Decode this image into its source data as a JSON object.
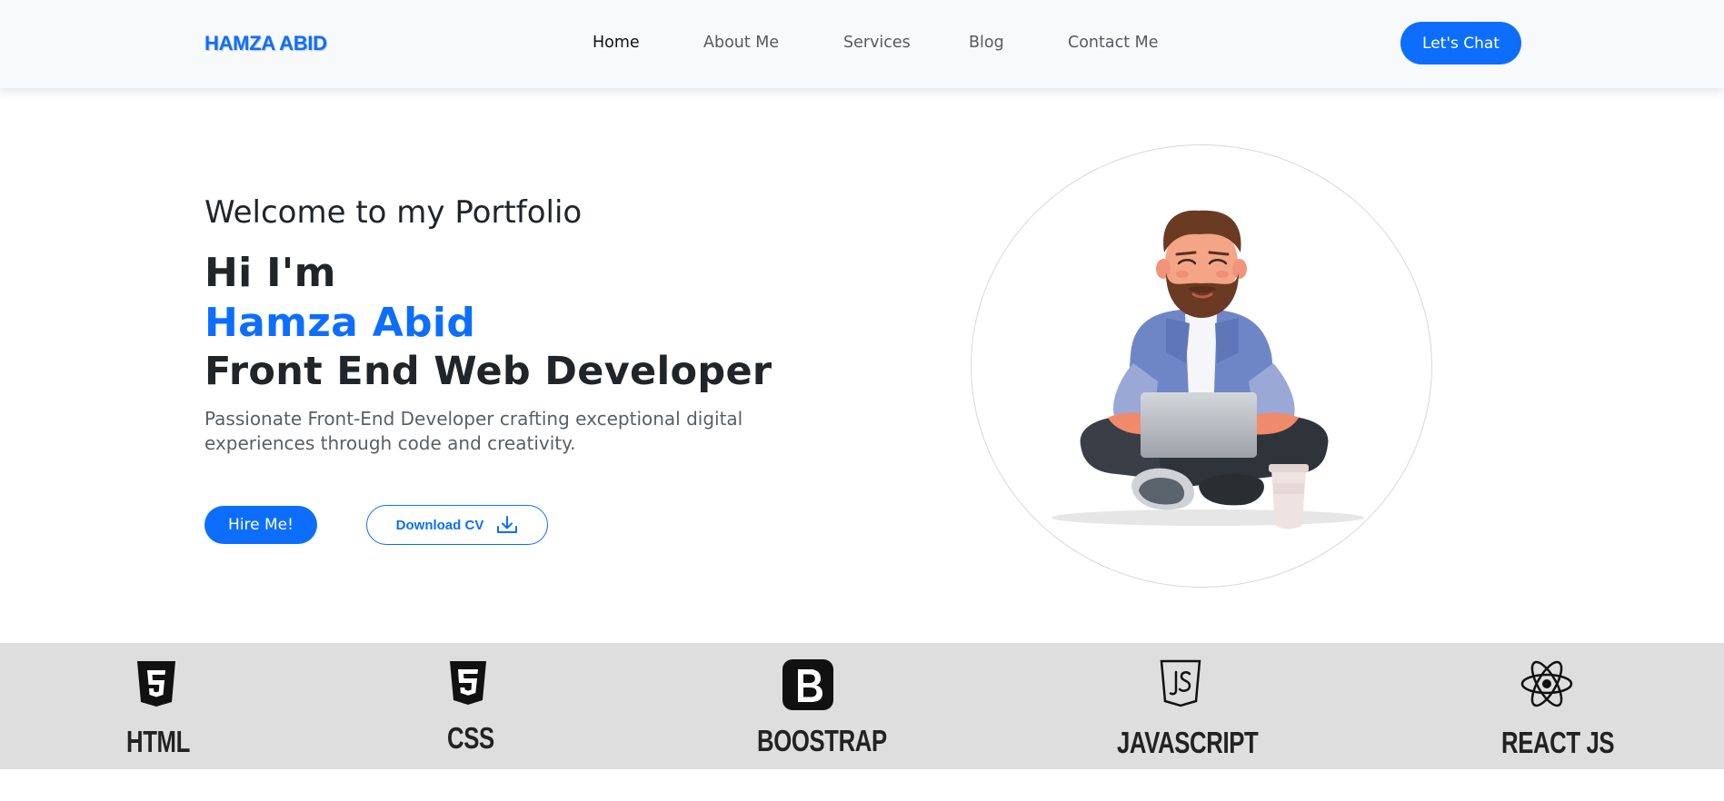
{
  "navbar": {
    "brand": "HAMZA ABID",
    "links": [
      {
        "label": "Home",
        "active": true
      },
      {
        "label": "About Me",
        "active": false
      },
      {
        "label": "Services",
        "active": false
      },
      {
        "label": "Blog",
        "active": false
      },
      {
        "label": "Contact Me",
        "active": false
      }
    ],
    "cta_label": "Let's Chat"
  },
  "hero": {
    "subtitle": "Welcome to my Portfolio",
    "line1": "Hi I'm",
    "line2": "Hamza Abid",
    "line3": "Front End Web Developer",
    "description": "Passionate Front-End Developer crafting exceptional digital experiences through code and creativity.",
    "hire_button": "Hire Me!",
    "cv_button": "Download CV",
    "cv_icon": "download-icon",
    "illustration": "developer-with-laptop-illustration"
  },
  "skills": [
    {
      "label": "HTML",
      "icon": "html5-icon"
    },
    {
      "label": "CSS",
      "icon": "css3-icon"
    },
    {
      "label": "BOOSTRAP",
      "icon": "bootstrap-icon"
    },
    {
      "label": "JAVASCRIPT",
      "icon": "javascript-icon"
    },
    {
      "label": "REACT JS",
      "icon": "react-icon"
    }
  ],
  "colors": {
    "accent": "#0d6efd",
    "navbar_bg": "#f8f9fa",
    "skills_bg": "#dedede"
  }
}
